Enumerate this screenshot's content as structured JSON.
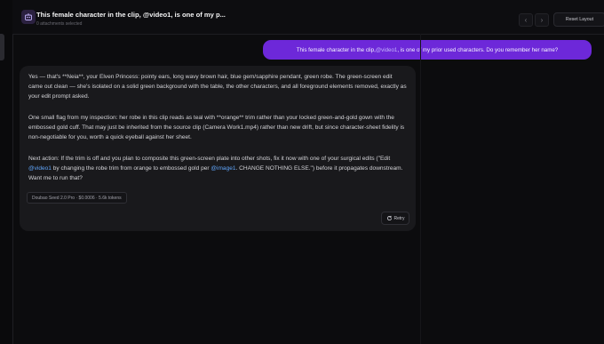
{
  "header": {
    "title": "This female character in the clip, @video1, is one of my p...",
    "subtitle": "0 attachments selected",
    "reset_label": "Reset Layout",
    "prev_icon": "chevron-left-icon",
    "next_icon": "chevron-right-icon",
    "app_icon": "character-icon"
  },
  "user_message": {
    "before": "This female character in the clip, ",
    "mention": "@video1",
    "after": ", is one of my prior used characters. Do you remember her name?"
  },
  "assistant_message": {
    "p1": "Yes — that's **Neia**, your Elven Princess: pointy ears, long wavy brown hair, blue gem/sapphire pendant, green robe. The green-screen edit came out clean — she's isolated on a solid green background with the table, the other characters, and all foreground elements removed, exactly as your edit prompt asked.",
    "p2": "One small flag from my inspection: her robe in this clip reads as teal with **orange** trim rather than your locked green-and-gold gown with the embossed gold cuff. That may just be inherited from the source clip (Camera Work1.mp4) rather than new drift, but since character-sheet fidelity is non-negotiable for you, worth a quick eyeball against her sheet.",
    "p3_a": "Next action: If the trim is off and you plan to composite this green-screen plate into other shots, fix it now with one of your surgical edits (\"Edit ",
    "p3_mention1": "@video1",
    "p3_b": " by changing the robe trim from orange to embossed gold per ",
    "p3_mention2": "@image1",
    "p3_c": ". CHANGE NOTHING ELSE.\") before it propagates downstream. Want me to run that?",
    "model_chip": "Doubao Seed 2.0 Pro · $0.0006 · 5.6k tokens",
    "retry_label": "Retry",
    "retry_icon": "refresh-icon"
  },
  "colors": {
    "accent": "#6d28d9",
    "mention_user": "#c4b5fd",
    "mention_assistant": "#60a5fa",
    "background": "#0c0c0e",
    "card": "#19191c"
  }
}
